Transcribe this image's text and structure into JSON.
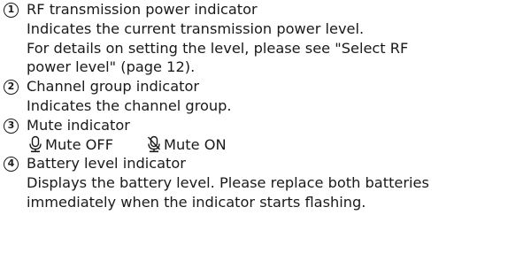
{
  "items": [
    {
      "number": "1",
      "title": "RF transmission power indicator",
      "lines": [
        "Indicates the current transmission power level.",
        "For details on setting the level, please see \"Select RF",
        "power level\" (page 12)."
      ]
    },
    {
      "number": "2",
      "title": "Channel group indicator",
      "lines": [
        "Indicates the channel group."
      ]
    },
    {
      "number": "3",
      "title": "Mute indicator",
      "mute_off_label": "Mute OFF",
      "mute_on_label": "Mute ON",
      "mute_off_icon": "microphone-icon",
      "mute_on_icon": "microphone-muted-icon"
    },
    {
      "number": "4",
      "title": "Battery level indicator",
      "lines": [
        "Displays the battery level. Please replace both batteries",
        "immediately when the indicator starts flashing."
      ]
    }
  ]
}
